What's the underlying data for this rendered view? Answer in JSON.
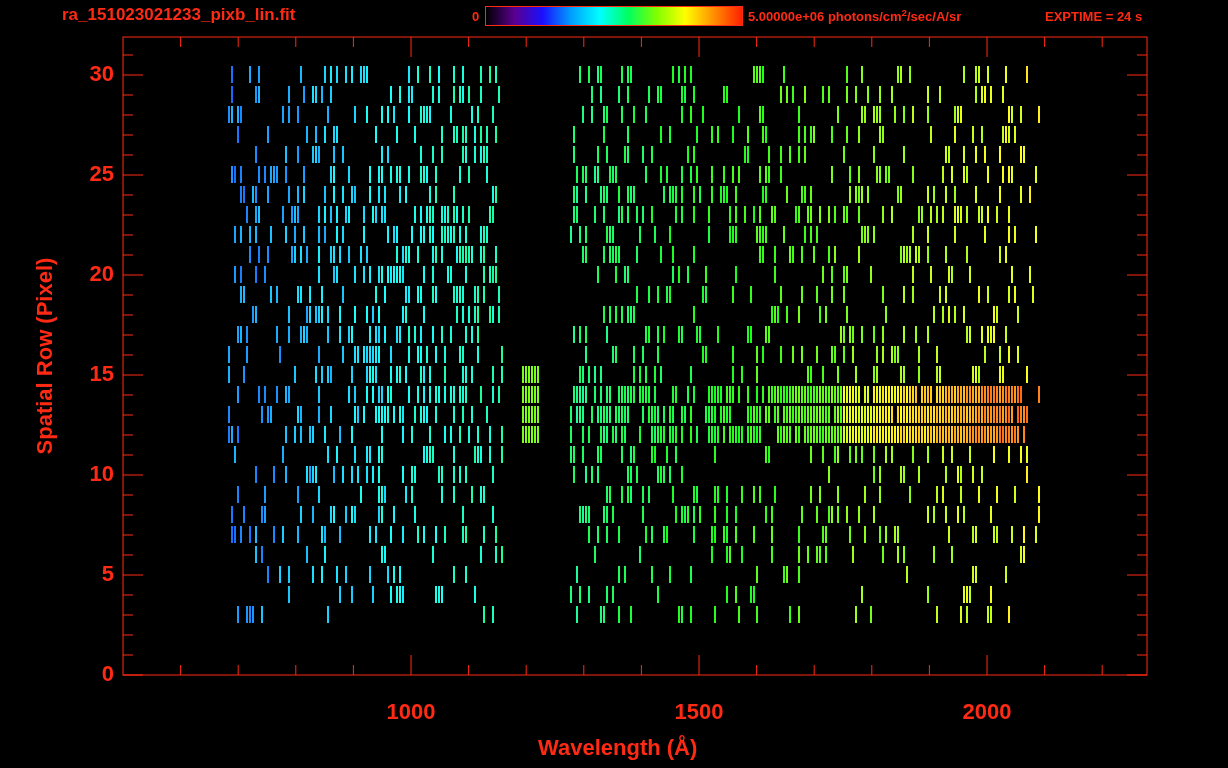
{
  "header": {
    "title": "ra_151023021233_pixb_lin.fit",
    "colorbar": {
      "min_label": "0",
      "max_label": "5.00000e+06 photons/cm$^{2}$/sec/A/sr"
    },
    "exptime": "EXPTIME = 24 s"
  },
  "plot": {
    "xlabel": "Wavelength (Å)",
    "ylabel": "Spatial Row (Pixel)",
    "xtick_labels": [
      "1000",
      "1500",
      "2000"
    ],
    "ytick_labels": [
      "30",
      "25",
      "20",
      "15",
      "10",
      "5",
      "0"
    ]
  }
}
